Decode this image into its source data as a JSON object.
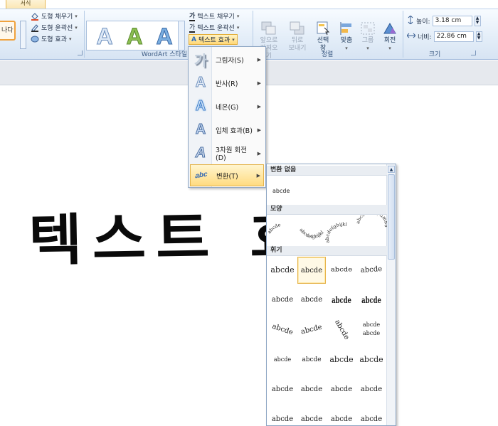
{
  "tab": {
    "active_label": "서식"
  },
  "ribbon": {
    "shape_button_label": "나다",
    "shape_commands": [
      {
        "label": "도형 채우기",
        "icon": "paint-bucket-icon"
      },
      {
        "label": "도형 윤곽선",
        "icon": "pen-outline-icon"
      },
      {
        "label": "도형 효과",
        "icon": "shape-effect-icon"
      }
    ],
    "wordart_glyph": "A",
    "wordart_colors": [
      "#c9dcf2",
      "#7fb04a",
      "#6a9ed6"
    ],
    "wordart_group_label": "WordArt 스타일",
    "text_commands": [
      {
        "label": "텍스트 채우기",
        "icon": "text-fill-icon"
      },
      {
        "label": "텍스트 윤곽선",
        "icon": "text-outline-icon"
      },
      {
        "label": "텍스트 효과",
        "icon": "text-effect-icon"
      }
    ],
    "arrange": [
      {
        "line1": "앞으로",
        "line2": "가져오기",
        "enabled": false
      },
      {
        "line1": "뒤로",
        "line2": "보내기",
        "enabled": false
      },
      {
        "line1": "선택",
        "line2": "창",
        "enabled": true
      },
      {
        "line1": "맞춤",
        "line2": "",
        "enabled": true
      },
      {
        "line1": "그룹",
        "line2": "",
        "enabled": false
      },
      {
        "line1": "회전",
        "line2": "",
        "enabled": true
      }
    ],
    "arrange_group_label": "정렬",
    "size": {
      "height_label": "높이:",
      "height_value": "3.18 cm",
      "width_label": "너비:",
      "width_value": "22.86 cm",
      "group_label": "크기"
    }
  },
  "slide": {
    "text": "텍스트 효과"
  },
  "text_effects_menu": {
    "items": [
      {
        "label": "그림자(S)",
        "icon": "shadow-icon",
        "glyph": "가"
      },
      {
        "label": "반사(R)",
        "icon": "reflection-icon",
        "glyph": "A"
      },
      {
        "label": "네온(G)",
        "icon": "glow-icon",
        "glyph": "A"
      },
      {
        "label": "입체 효과(B)",
        "icon": "bevel-icon",
        "glyph": "A"
      },
      {
        "label": "3차원 회전(D)",
        "icon": "3d-rotation-icon",
        "glyph": "A"
      },
      {
        "label": "변환(T)",
        "icon": "transform-icon",
        "glyph": "abc",
        "highlighted": true
      }
    ]
  },
  "transform_panel": {
    "sections": {
      "no_transform": "변환 없음",
      "follow_path": "모양",
      "warp": "휘기"
    },
    "no_transform_sample": "abcde",
    "path_samples": [
      "abcde",
      "abcdefghijkl",
      "abcdefghijkl",
      "abcdefghijklmno"
    ],
    "warp_sample": "abcde"
  }
}
